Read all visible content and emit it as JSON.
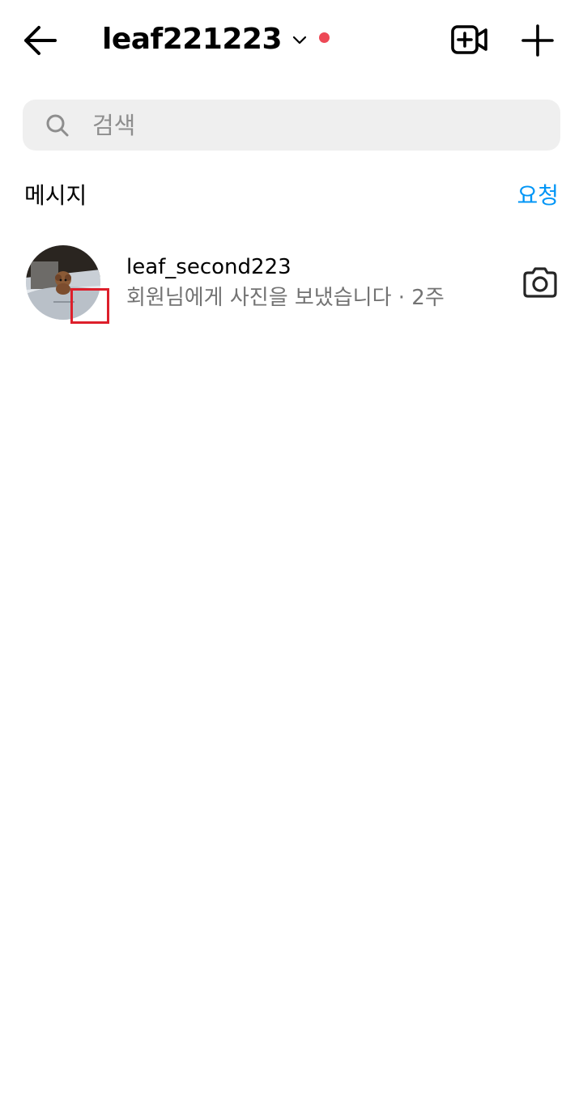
{
  "header": {
    "back_icon": "arrow-left-icon",
    "username": "leaf221223",
    "switch_icon": "chevron-down-icon",
    "notification_dot_color": "#ed4956",
    "video_call_icon": "video-plus-icon",
    "new_message_icon": "plus-icon"
  },
  "search": {
    "icon": "search-icon",
    "placeholder": "검색",
    "value": ""
  },
  "messages_section": {
    "title": "메시지",
    "requests_label": "요청",
    "requests_color": "#0095f6"
  },
  "threads": [
    {
      "username": "leaf_second223",
      "preview": "회원님에게 사진을 보냈습니다 · 2주",
      "action_icon": "camera-icon"
    }
  ]
}
